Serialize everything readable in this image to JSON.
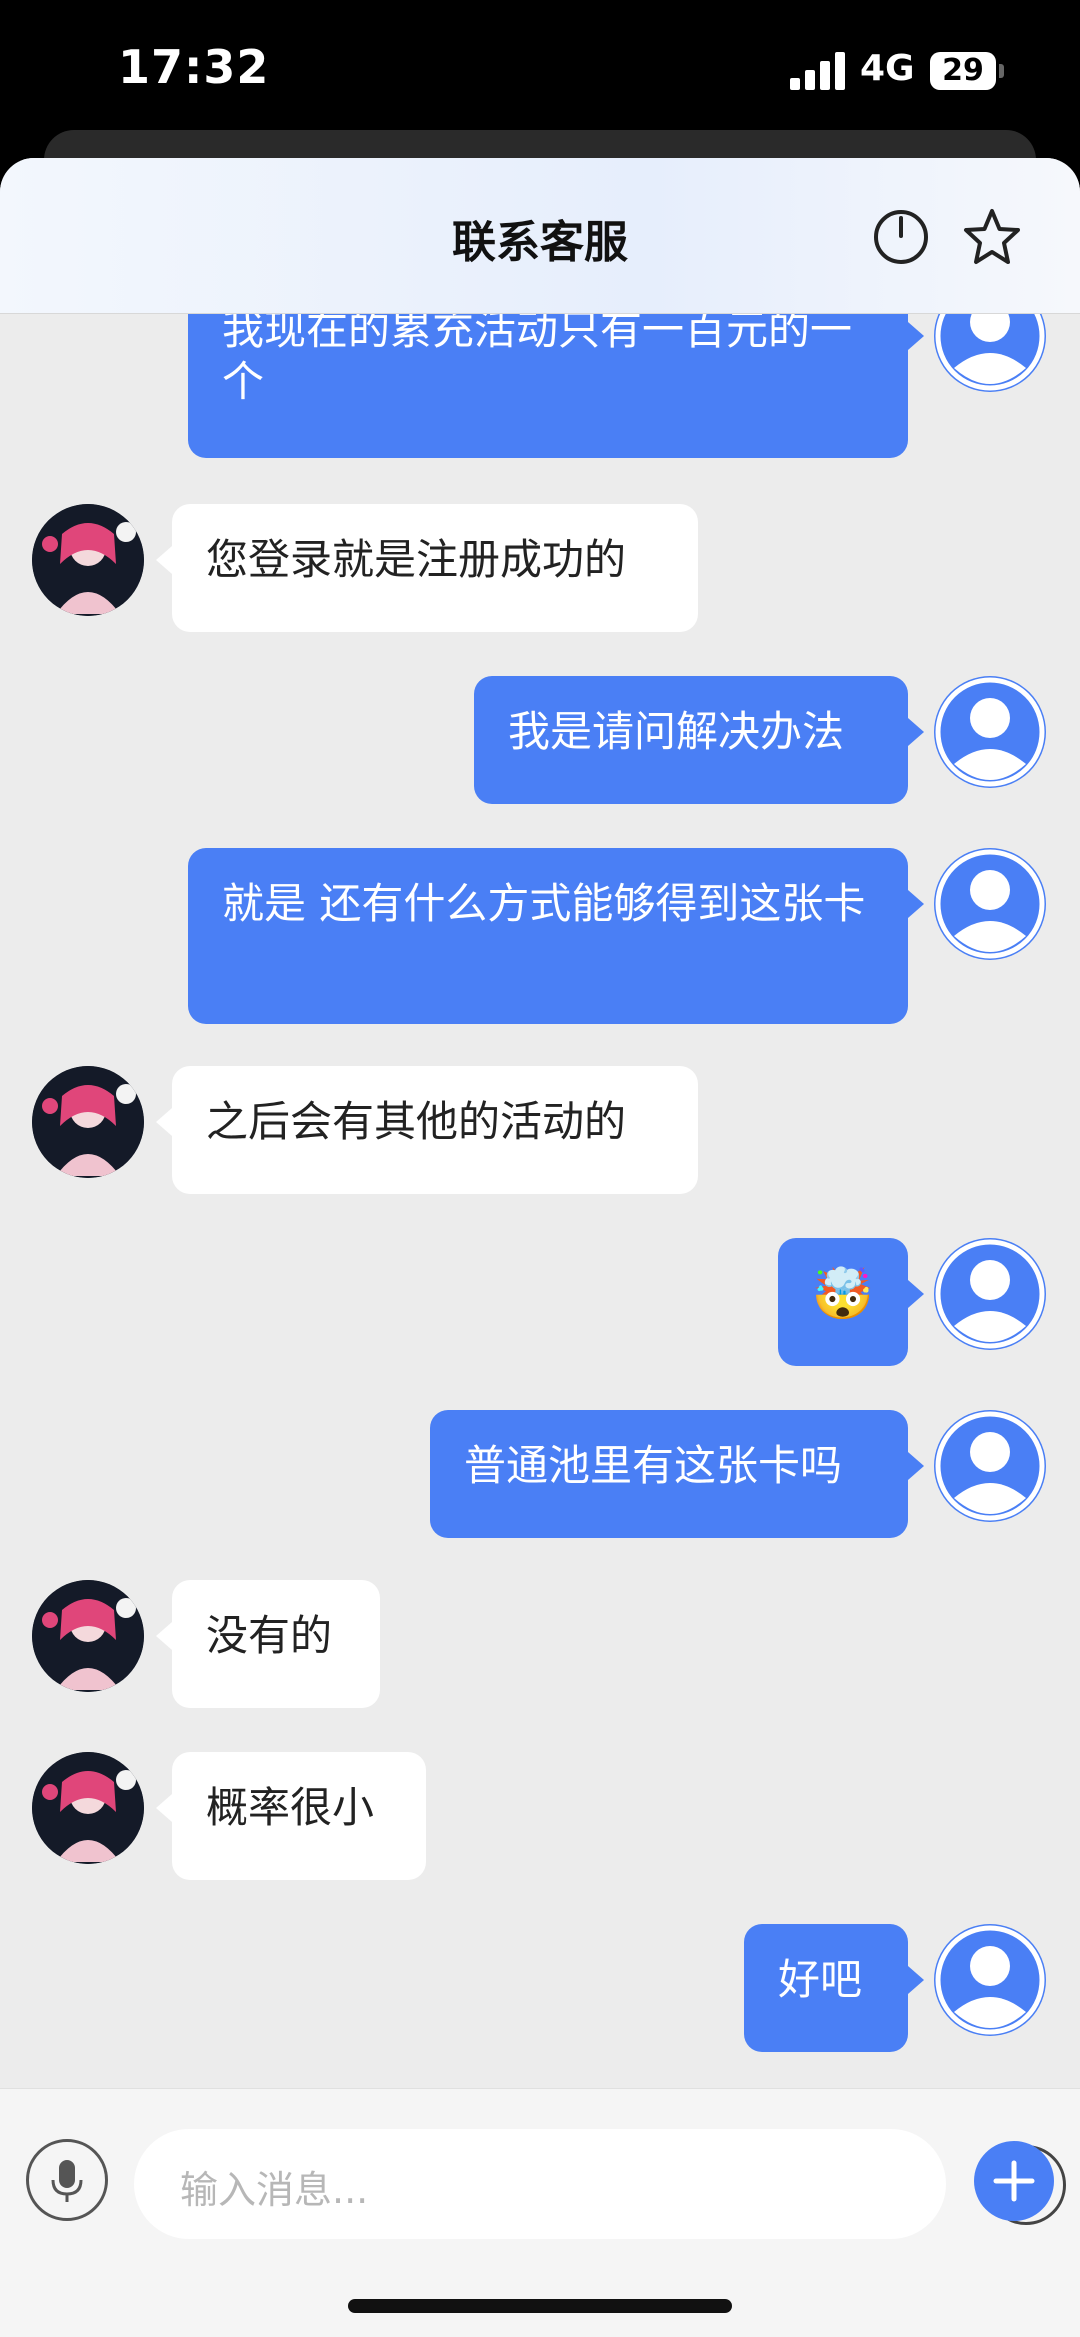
{
  "status_bar": {
    "time": "17:32",
    "network": "4G",
    "battery": "29"
  },
  "header": {
    "title": "联系客服",
    "power_icon": "power-icon",
    "star_icon": "star-icon"
  },
  "colors": {
    "accent": "#4a7ff5",
    "agent_bubble": "#ffffff",
    "background": "#ececec"
  },
  "messages": [
    {
      "from": "user",
      "text": "我现在的累充活动只有一百元的一个"
    },
    {
      "from": "agent",
      "text": "您登录就是注册成功的"
    },
    {
      "from": "user",
      "text": "我是请问解决办法"
    },
    {
      "from": "user",
      "text": "就是 还有什么方式能够得到这张卡"
    },
    {
      "from": "agent",
      "text": "之后会有其他的活动的"
    },
    {
      "from": "user",
      "text": "🤯"
    },
    {
      "from": "user",
      "text": "普通池里有这张卡吗"
    },
    {
      "from": "agent",
      "text": "没有的"
    },
    {
      "from": "agent",
      "text": "概率很小"
    },
    {
      "from": "user",
      "text": "好吧"
    }
  ],
  "input": {
    "placeholder": "输入消息..."
  }
}
